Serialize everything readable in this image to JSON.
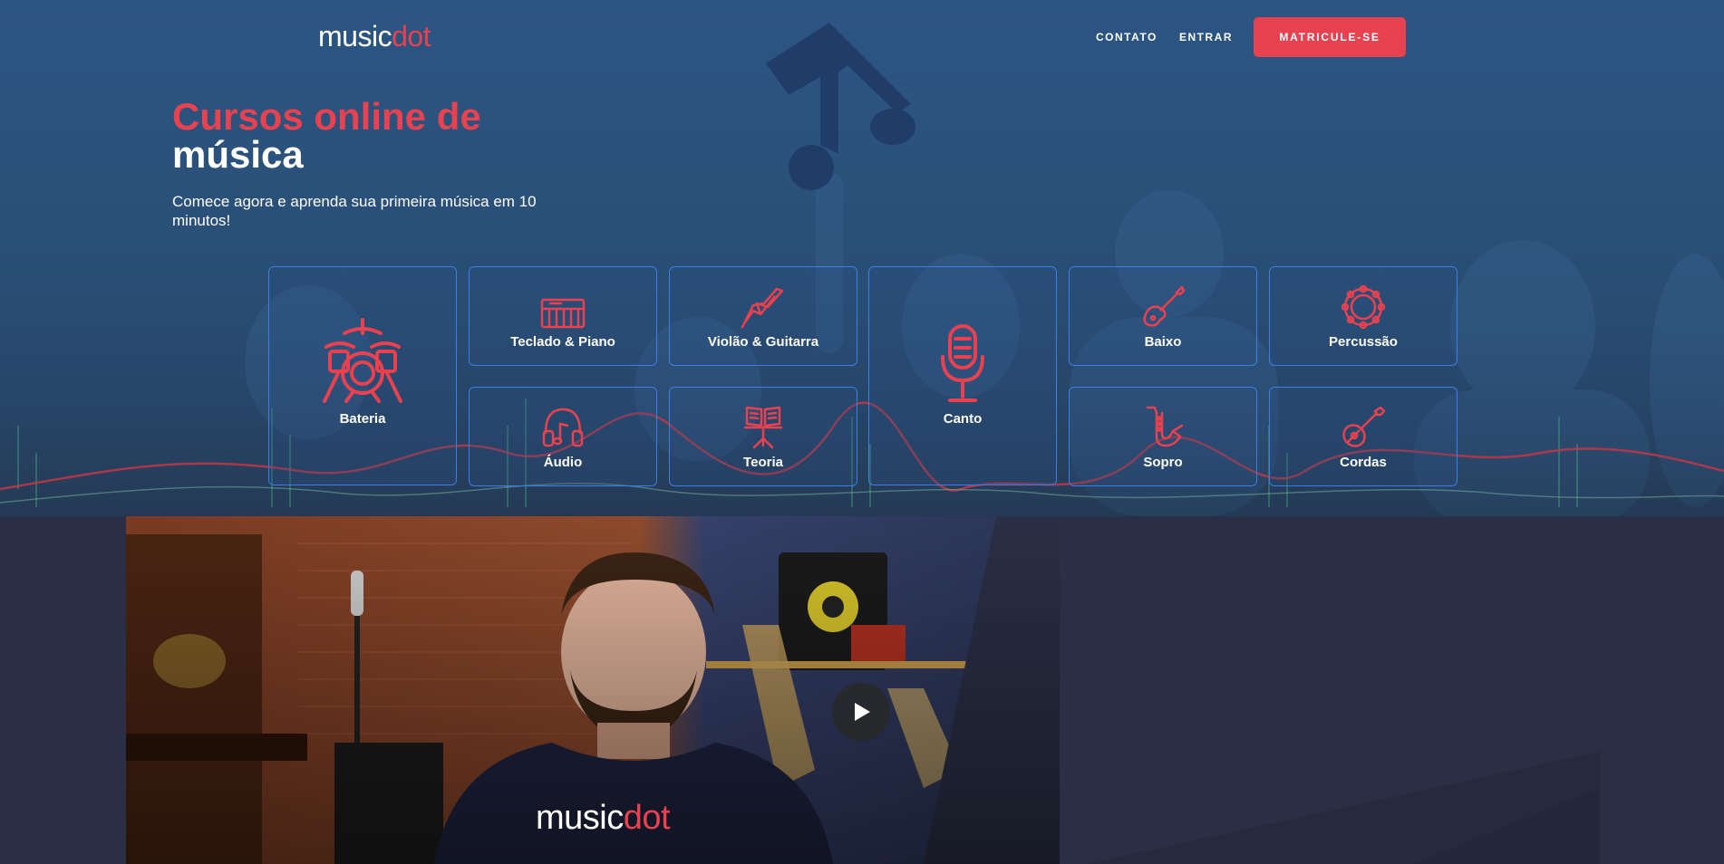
{
  "header": {
    "logo_text_1": "music",
    "logo_text_2": "dot",
    "nav": [
      "CONTATO",
      "ENTRAR"
    ],
    "cta_label": "MATRICULE-SE"
  },
  "hero": {
    "title_line1": "Cursos online de",
    "title_line2": "música",
    "subtitle": "Comece agora e aprenda sua primeira música em 10 minutos!"
  },
  "categories": [
    {
      "label": "Bateria",
      "icon": "drum-kit-icon"
    },
    {
      "label": "Teclado & Piano",
      "icon": "keyboard-icon"
    },
    {
      "label": "Violão & Guitarra",
      "icon": "electric-guitar-icon"
    },
    {
      "label": "Canto",
      "icon": "microphone-icon"
    },
    {
      "label": "Baixo",
      "icon": "bass-guitar-icon"
    },
    {
      "label": "Percussão",
      "icon": "tambourine-icon"
    },
    {
      "label": "Áudio",
      "icon": "headphones-icon"
    },
    {
      "label": "Teoria",
      "icon": "music-stand-icon"
    },
    {
      "label": "Sopro",
      "icon": "saxophone-icon"
    },
    {
      "label": "Cordas",
      "icon": "mandolin-icon"
    }
  ],
  "video": {
    "shirt_logo_1": "music",
    "shirt_logo_2": "dot",
    "play_icon": "play-icon"
  },
  "colors": {
    "accent": "#e8414f",
    "card_border": "#3b7ee6",
    "hero_bg": "#2d5583",
    "section_bg": "#2a2f45"
  }
}
